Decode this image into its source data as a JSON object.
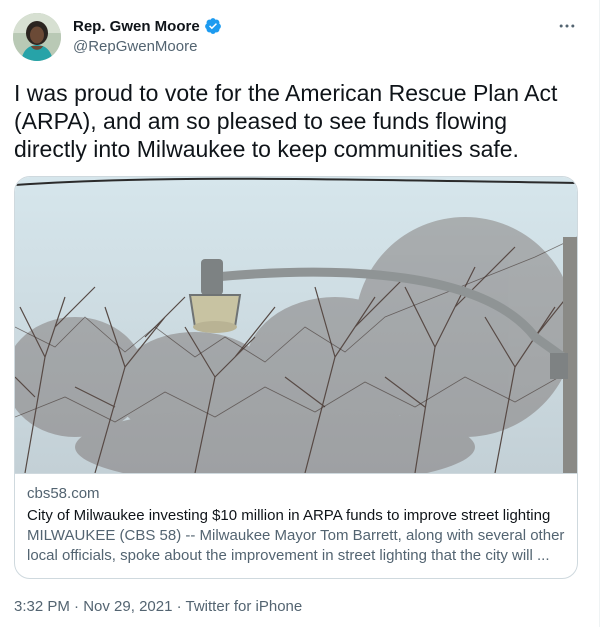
{
  "author": {
    "name": "Rep. Gwen Moore",
    "handle": "@RepGwenMoore",
    "verified_icon": "verified-badge-icon",
    "avatar_icon": "avatar"
  },
  "menu": {
    "more_icon": "more-options-icon"
  },
  "tweet": {
    "text": "I was proud to vote for the American Rescue Plan Act\n(ARPA), and am so pleased to see funds flowing\ndirectly into Milwaukee to keep communities safe."
  },
  "card": {
    "domain": "cbs58.com",
    "title": "City of Milwaukee investing $10 million in ARPA funds to improve street lighting",
    "description": "MILWAUKEE (CBS 58) -- Milwaukee Mayor Tom Barrett, along with several other\nlocal officials, spoke about the improvement in street lighting that the city will ..."
  },
  "meta": {
    "time": "3:32 PM",
    "separator": " · ",
    "date": "Nov 29, 2021",
    "source": "Twitter for iPhone"
  },
  "colors": {
    "text_primary": "#0f1419",
    "text_secondary": "#536471",
    "verified_blue": "#1d9bf0",
    "border": "#cfd9de"
  }
}
